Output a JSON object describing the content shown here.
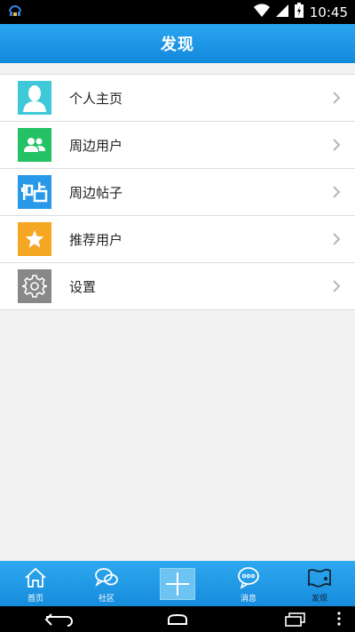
{
  "status_bar": {
    "time": "10:45",
    "icons": [
      "app-notification-icon",
      "wifi-icon",
      "signal-icon",
      "battery-icon"
    ]
  },
  "header": {
    "title": "发现"
  },
  "menu": {
    "items": [
      {
        "label": "个人主页",
        "icon": "person-icon",
        "color": "#3fc8d8"
      },
      {
        "label": "周边用户",
        "icon": "users-icon",
        "color": "#25c165"
      },
      {
        "label": "周边帖子",
        "icon": "post-icon",
        "color": "#2898e8"
      },
      {
        "label": "推荐用户",
        "icon": "star-icon",
        "color": "#f5a623"
      },
      {
        "label": "设置",
        "icon": "gear-icon",
        "color": "#888888"
      }
    ]
  },
  "tabbar": {
    "tabs": [
      {
        "label": "首页",
        "icon": "home-icon"
      },
      {
        "label": "社区",
        "icon": "chat-bubbles-icon"
      },
      {
        "label": "",
        "icon": "plus-icon"
      },
      {
        "label": "消息",
        "icon": "message-icon"
      },
      {
        "label": "发现",
        "icon": "discover-icon",
        "active": true
      }
    ]
  },
  "colors": {
    "accent": "#1a8fe0",
    "header_gradient_top": "#2aa6f0",
    "header_gradient_bottom": "#1388dc"
  }
}
